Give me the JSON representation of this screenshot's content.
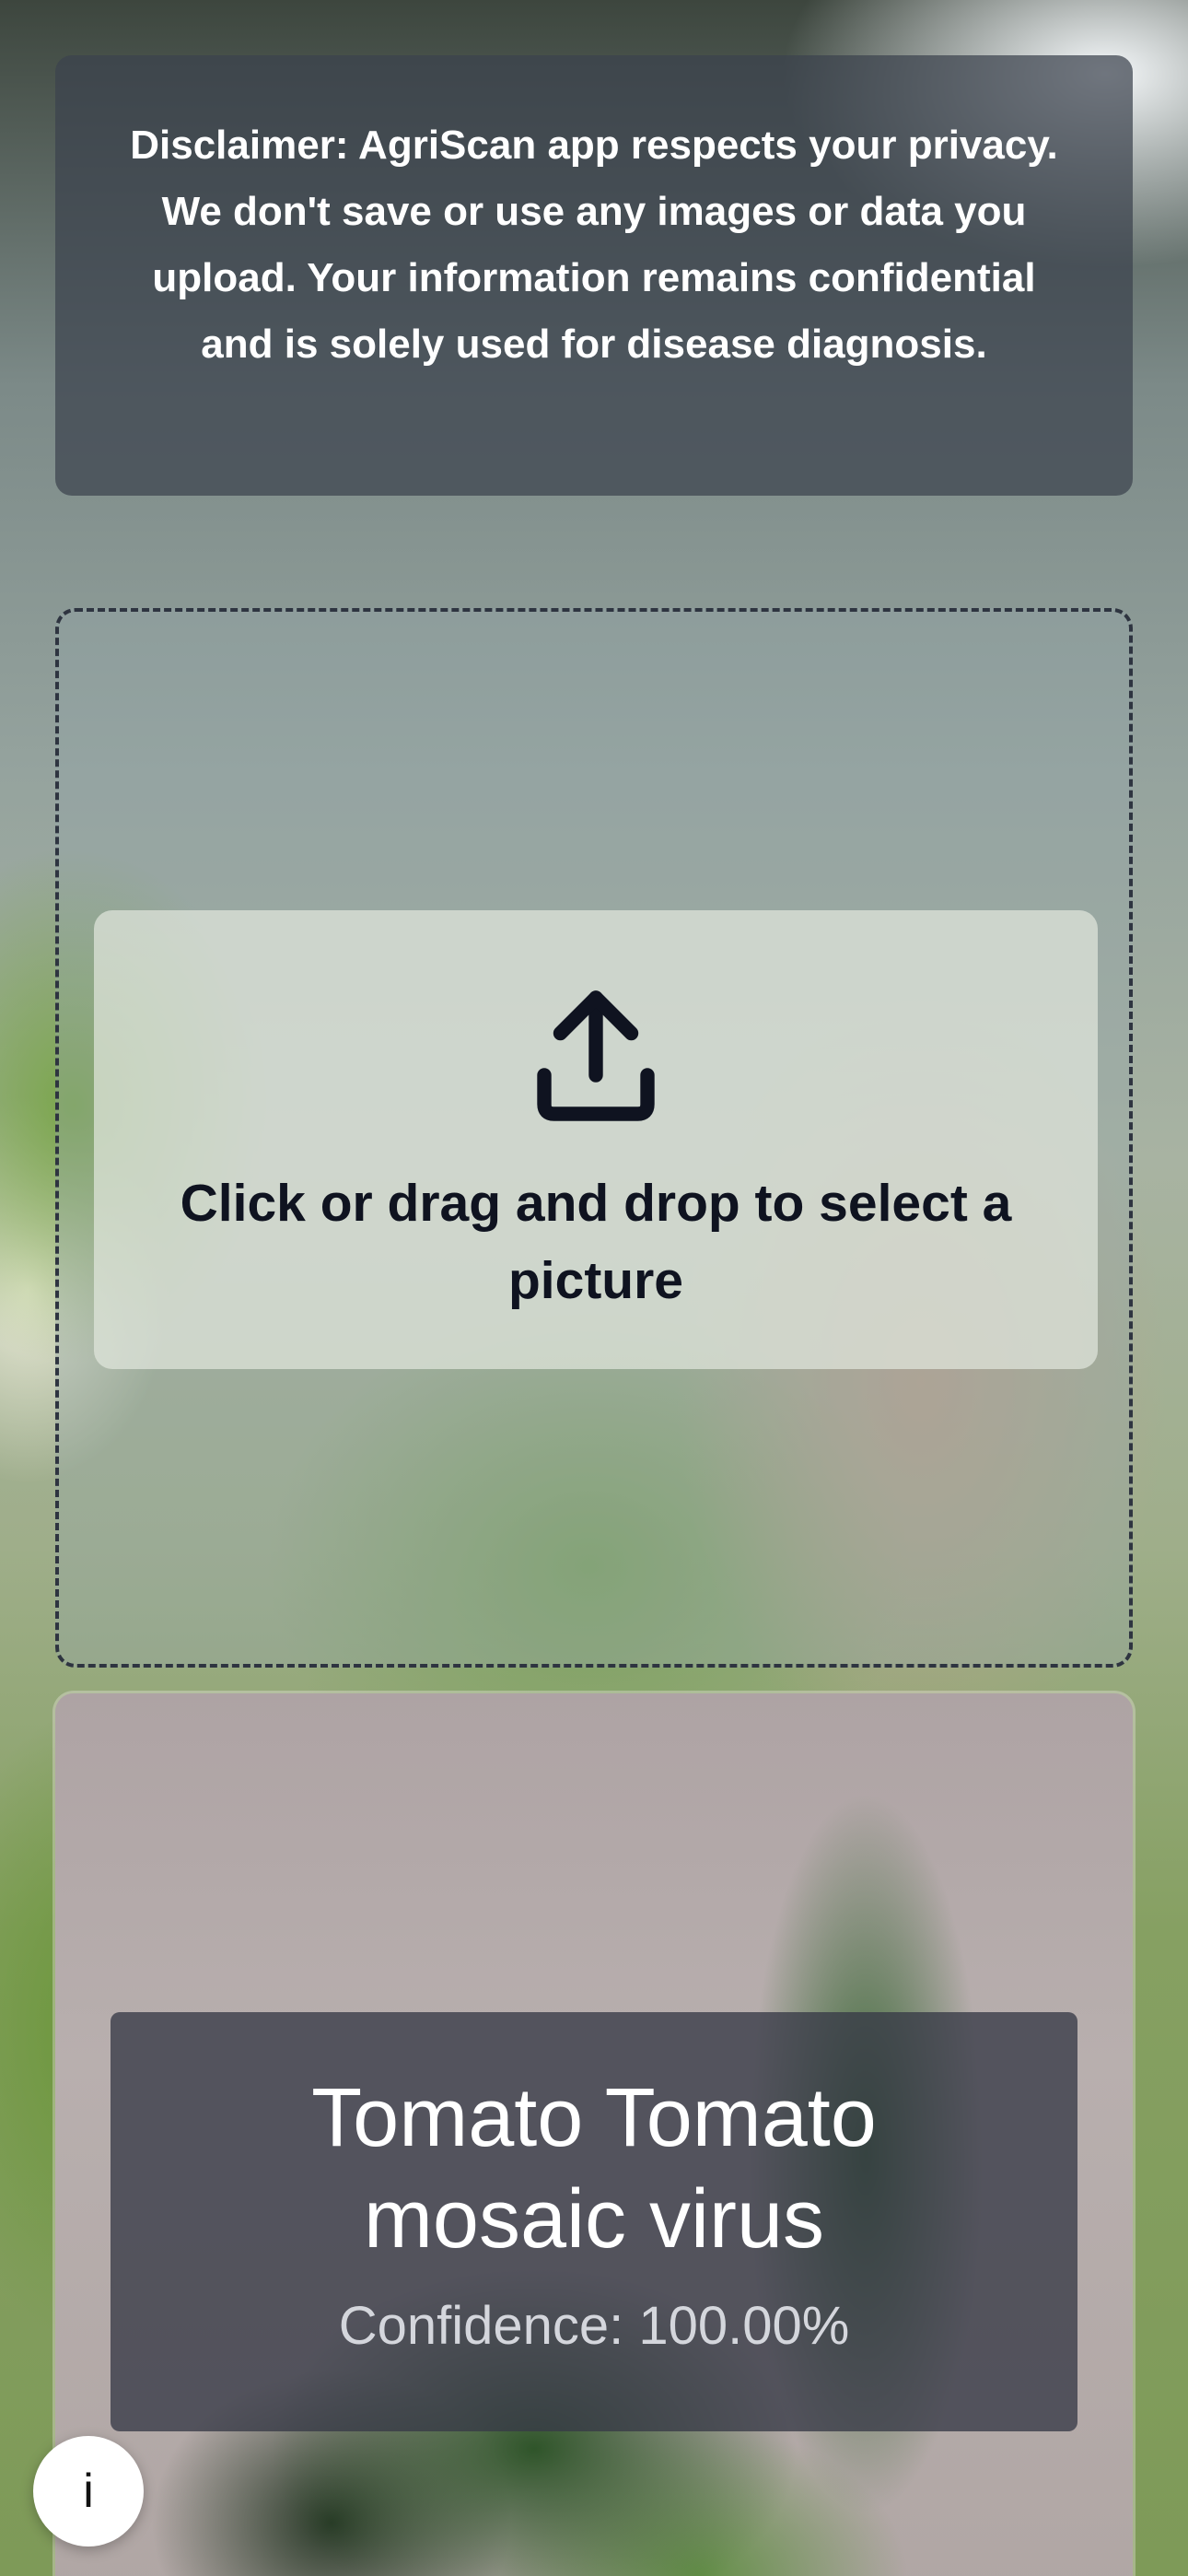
{
  "disclaimer": {
    "text": "Disclaimer: AgriScan app respects your privacy. We don't save or use any images or data you upload. Your information remains confidential and is solely used for disease diagnosis."
  },
  "upload": {
    "icon": "upload-icon",
    "label": "Click or drag and drop to select a picture"
  },
  "result": {
    "title": "Tomato Tomato mosaic virus",
    "confidence": "Confidence: 100.00%"
  },
  "info_button": {
    "label": "i"
  },
  "colors": {
    "disclaimer_bg": "#3c424e",
    "text_dark": "#0f1320",
    "overlay_bg": "#373a46"
  }
}
